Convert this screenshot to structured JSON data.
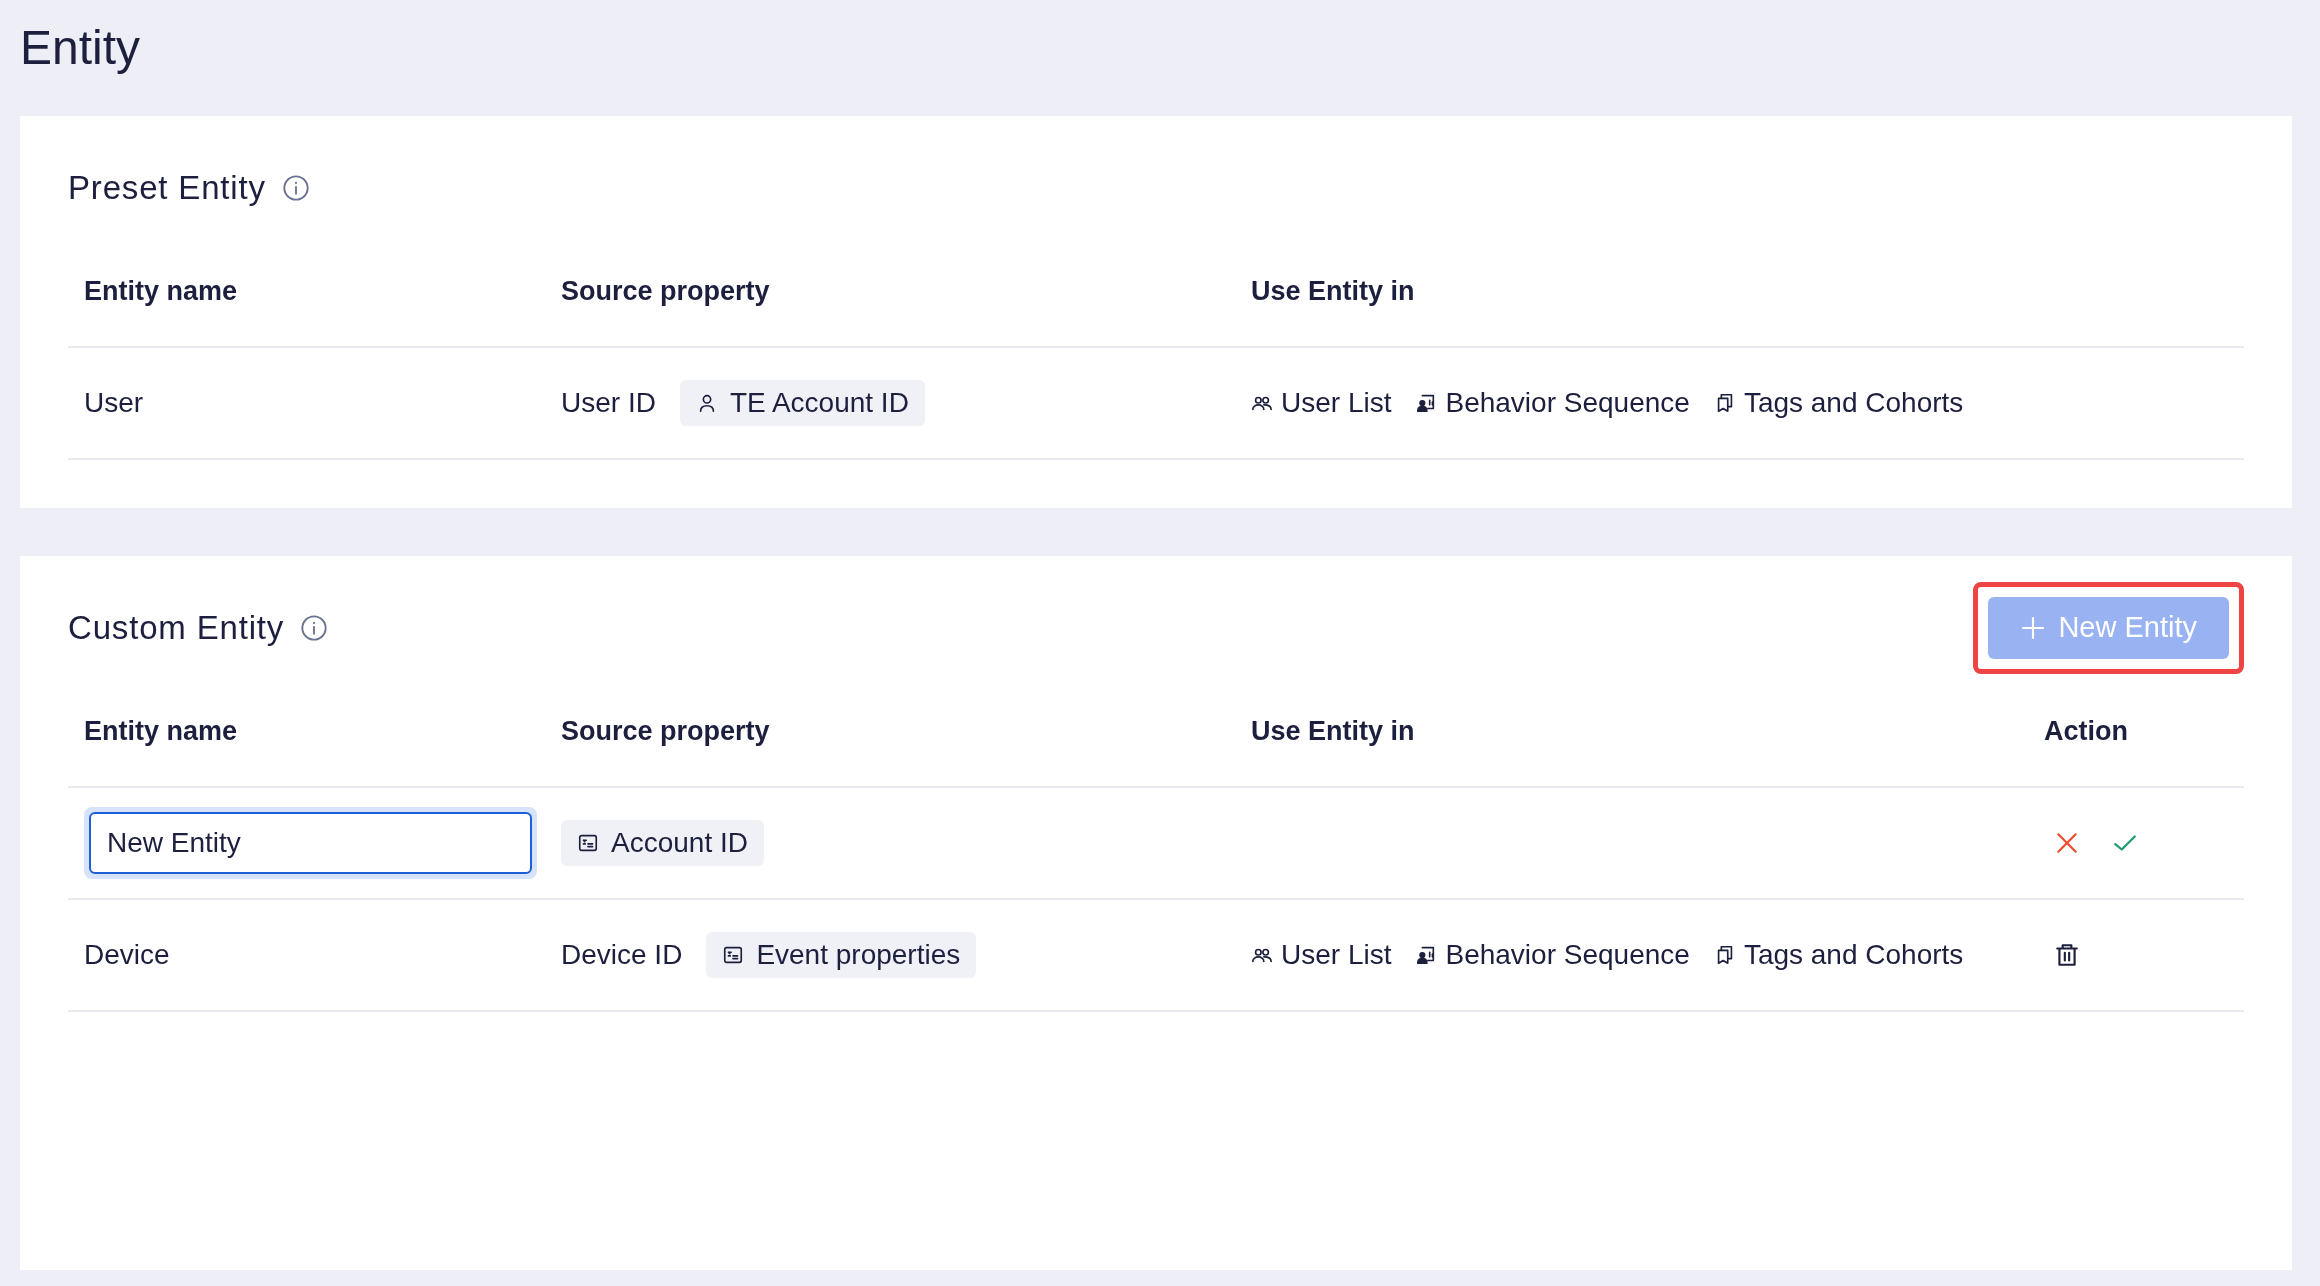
{
  "page_title": "Entity",
  "sections": [
    {
      "title": "Preset Entity",
      "columns": [
        "Entity name",
        "Source property",
        "Use Entity in"
      ],
      "rows": [
        {
          "kind": "text",
          "name": "User",
          "source": [
            {
              "kind": "text",
              "label": "User ID"
            },
            {
              "kind": "tag",
              "label": "TE Account ID"
            }
          ],
          "uses": [
            {
              "label": "User List"
            },
            {
              "label": "Behavior Sequence"
            },
            {
              "label": "Tags and Cohorts"
            }
          ]
        }
      ]
    },
    {
      "title": "Custom Entity",
      "button": {
        "label": "New Entity",
        "disabled": true,
        "highlighted": true
      },
      "columns": [
        "Entity name",
        "Source property",
        "Use Entity in",
        "Action"
      ],
      "rows": [
        {
          "kind": "input",
          "name": "New Entity",
          "source": [
            {
              "kind": "tag",
              "label": "Account ID"
            }
          ],
          "uses": []
        },
        {
          "kind": "text",
          "name": "Device",
          "source": [
            {
              "kind": "text",
              "label": "Device ID"
            },
            {
              "kind": "tag",
              "label": "Event properties"
            }
          ],
          "uses": [
            {
              "label": "User List"
            },
            {
              "label": "Behavior Sequence"
            },
            {
              "label": "Tags and Cohorts"
            }
          ]
        }
      ]
    }
  ]
}
